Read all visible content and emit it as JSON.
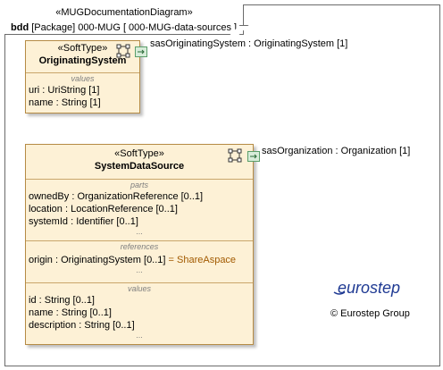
{
  "diagram": {
    "stereotype": "«MUGDocumentationDiagram»",
    "kind": "bdd",
    "title": "[Package] 000-MUG [ 000-MUG-data-sources ]"
  },
  "originating_system": {
    "stereotype": "«SoftType»",
    "name": "OriginatingSystem",
    "values_title": "values",
    "values": [
      {
        "name": "uri",
        "type": ": UriString [1]"
      },
      {
        "name": "name",
        "type": ": String [1]"
      }
    ],
    "port_label": "sasOriginatingSystem : OriginatingSystem [1]"
  },
  "system_data_source": {
    "stereotype": "«SoftType»",
    "name": "SystemDataSource",
    "parts_title": "parts",
    "parts": [
      {
        "name": "ownedBy",
        "type": ": OrganizationReference [0..1]"
      },
      {
        "name": "location",
        "type": ": LocationReference [0..1]"
      },
      {
        "name": "systemId",
        "type": ": Identifier [0..1]"
      }
    ],
    "references_title": "references",
    "references": [
      {
        "name": "origin",
        "type": ": OriginatingSystem [0..1]",
        "default": "= ShareAspace"
      }
    ],
    "values_title": "values",
    "values": [
      {
        "name": "id",
        "type": ": String [0..1]"
      },
      {
        "name": "name",
        "type": ": String [0..1]"
      },
      {
        "name": "description",
        "type": ": String [0..1]"
      }
    ],
    "ellipsis": "...",
    "port_label": "sasOrganization : Organization [1]"
  },
  "branding": {
    "logo_text": "eurostep",
    "copyright": "© Eurostep Group",
    "logo_color": "#1f3a93"
  }
}
